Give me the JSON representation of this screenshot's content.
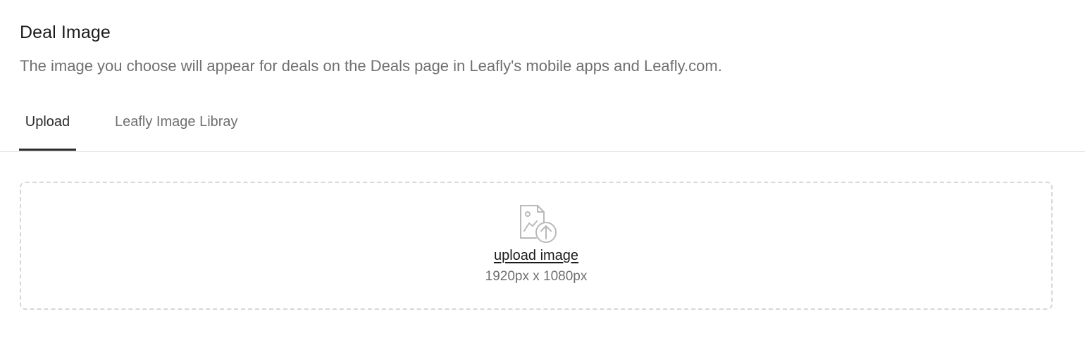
{
  "section": {
    "title": "Deal Image",
    "description": "The image you choose will appear for deals on the Deals page in Leafly's mobile apps and Leafly.com."
  },
  "tabs": [
    {
      "label": "Upload",
      "active": true
    },
    {
      "label": "Leafly Image Libray",
      "active": false
    }
  ],
  "dropzone": {
    "icon": "image-upload-icon",
    "action_label": "upload image",
    "dimensions": "1920px x 1080px"
  },
  "colors": {
    "text_primary": "#1b1b1b",
    "text_secondary": "#707070",
    "active_tab_underline": "#2b2b2b",
    "divider": "#dddddd",
    "dropzone_border": "#d7d7d7",
    "icon": "#b9b9b9"
  }
}
